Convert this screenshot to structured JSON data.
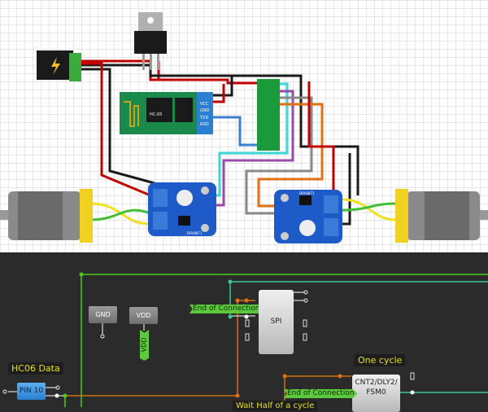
{
  "breadboard": {
    "bt_module": {
      "name": "HC-05",
      "pins": [
        "VCC",
        "GND",
        "TXD",
        "RXD"
      ]
    },
    "driver_chip_label": "DRV8871",
    "colors": {
      "wire_red": "#c00000",
      "wire_black": "#1a1a1a",
      "wire_blue": "#3a7fd0",
      "wire_cyan": "#3cd6d6",
      "wire_purple": "#9a4aa8",
      "wire_gray": "#888888",
      "wire_orange": "#e07010",
      "wire_yellow": "#f0e020",
      "wire_green": "#40c030",
      "board_blue": "#1f5bc8"
    }
  },
  "schematic": {
    "gnd_label": "GND",
    "vdd_label": "VDD",
    "vdd_tag": "VDD",
    "spi_label": "SPI",
    "end_conn_1": "End of Connection",
    "end_conn_2": "End of Connection",
    "hc06_label": "HC06 Data",
    "pin_label": "PIN 10",
    "one_cycle_label": "One cycle",
    "cnt_label": "CNT2/DLY2/\nFSM0",
    "wait_label": "Wait Half of a cycle",
    "colors": {
      "bg": "#2b2b2b",
      "green": "#4ccc1a",
      "teal": "#3dc890",
      "orange": "#d07010",
      "label_yellow": "#e6e01a"
    }
  }
}
